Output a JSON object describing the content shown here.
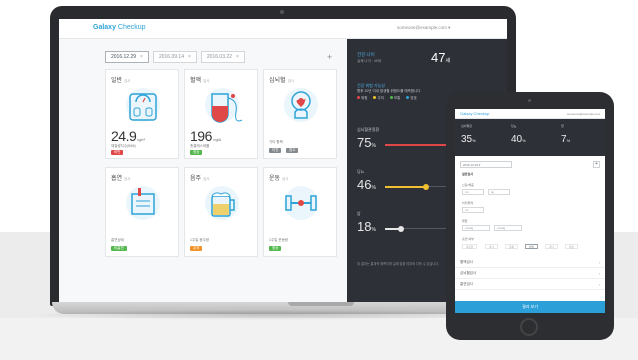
{
  "app": {
    "brand_a": "Galaxy",
    "brand_b": "Checkup",
    "user": "someone@example.com"
  },
  "tabs": [
    {
      "label": "2016.12.29",
      "active": true
    },
    {
      "label": "2016.09.14",
      "active": false
    },
    {
      "label": "2016.03.22",
      "active": false
    }
  ],
  "tab_close": "×",
  "add_label": "+",
  "cards": [
    {
      "title": "일반",
      "subtitle": "검사",
      "icon": "scale-icon",
      "value": "24.9",
      "unit": "kg/m²",
      "detail": "체질량지수(BMI)",
      "badge": "비만",
      "badge_color": "red"
    },
    {
      "title": "혈액",
      "subtitle": "검사",
      "icon": "blood-bag-icon",
      "value": "196",
      "unit": "mg/dL",
      "detail": "총콜레스테롤",
      "badge": "정상",
      "badge_color": "green"
    },
    {
      "title": "심뇌혈",
      "subtitle": "검사",
      "icon": "brain-heart-icon",
      "value": "",
      "unit": "",
      "detail": "기타 항목",
      "badge": "이전",
      "badge2": "참고",
      "badge_color": "gray"
    },
    {
      "title": "흡연",
      "subtitle": "검사",
      "icon": "cigarette-icon",
      "value": "",
      "unit": "",
      "detail": "흡연상태",
      "badge": "비흡연",
      "badge_color": "green"
    },
    {
      "title": "음주",
      "subtitle": "검사",
      "icon": "beer-icon",
      "value": "",
      "unit": "",
      "detail": "1주일 음주량",
      "badge": "주의",
      "badge_color": "orange"
    },
    {
      "title": "운동",
      "subtitle": "검사",
      "icon": "dumbbell-icon",
      "value": "",
      "unit": "",
      "detail": "1주일 운동량",
      "badge": "정상",
      "badge_color": "green"
    }
  ],
  "right": {
    "age_label": "건강 나이",
    "age_sub": "실제 나이 · 45세",
    "age_value": "47",
    "age_unit": "세",
    "header": "건강 위험 가능성",
    "desc": "향후 10년 이내 발생할 위험도를 예측합니다",
    "legend": [
      {
        "label": "위험",
        "color": "#e04747"
      },
      {
        "label": "주의",
        "color": "#f0c030"
      },
      {
        "label": "보통",
        "color": "#54b84e"
      },
      {
        "label": "양호",
        "color": "#2ea3d8"
      }
    ],
    "metrics": [
      {
        "label": "심뇌혈관질환",
        "value": "75",
        "unit": "%",
        "level": 0.75,
        "color": "#e04747"
      },
      {
        "label": "당뇨",
        "value": "46",
        "unit": "%",
        "level": 0.46,
        "color": "#f0c030"
      },
      {
        "label": "암",
        "value": "18",
        "unit": "%",
        "level": 0.18,
        "color": "#e6e6e6"
      }
    ],
    "footnote": "위 결과는 통계적 예측이며 실제 질환 여부와 다를 수 있습니다."
  },
  "tablet": {
    "brand": "Galaxy Checkup",
    "user": "someone@example.com",
    "metrics": [
      {
        "label": "심뇌혈관",
        "value": "35",
        "unit": "%"
      },
      {
        "label": "당뇨",
        "value": "40",
        "unit": "%"
      },
      {
        "label": "암",
        "value": "7",
        "unit": "%"
      }
    ],
    "date": "2016.12.29",
    "section": "일반검사",
    "fields": [
      {
        "label": "신장/체중",
        "a": "cm",
        "b": "kg"
      },
      {
        "label": "허리둘레",
        "a": "cm",
        "b": ""
      },
      {
        "label": "혈압",
        "a": "mmHg",
        "b": "mmHg"
      }
    ],
    "chips_label": "흡연 여부",
    "chips": [
      "비흡연",
      "과거",
      "현재",
      "선택",
      "기타",
      "미상"
    ],
    "rows": [
      "혈액검사",
      "심뇌혈검사",
      "흡연검사"
    ],
    "submit": "결과 보기"
  }
}
